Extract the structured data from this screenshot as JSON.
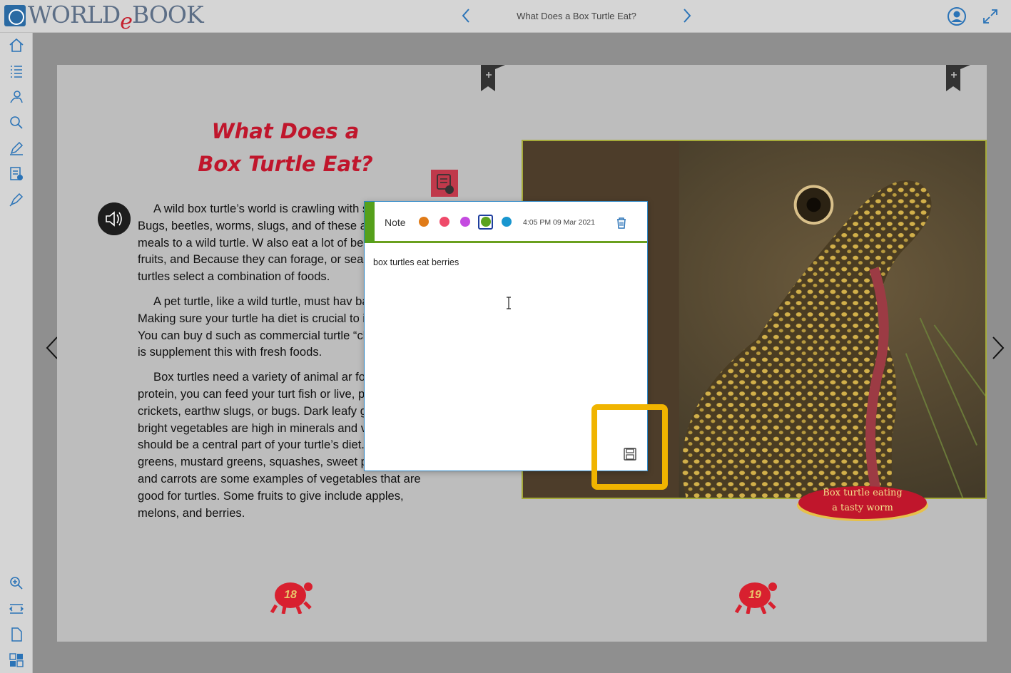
{
  "header": {
    "logo_text_prefix": "WORLD",
    "logo_text_e": "e",
    "logo_text_suffix": "BOOK",
    "book_title": "What Does a Box Turtle Eat?"
  },
  "page": {
    "title_line1": "What Does a",
    "title_line2": "Box Turtle Eat?",
    "paragraphs": [
      "A wild box turtle’s world is crawling with snacks. Bugs, beetles, worms, slugs, and of these are tasty meals to a wild turtle. W also eat a lot of berries, other fruits, and Because they can forage, or search, for f turtles select a combination of foods.",
      "A pet turtle, like a wild turtle, must hav balanced diet. Making sure your turtle ha diet is crucial to its health. You can buy d such as commercial turtle “chow,” but it is supplement this with fresh foods.",
      "Box turtles need a variety of animal ar foods. For protein, you can feed your turt fish or live, pesticide-free crickets, earthw slugs, or bugs. Dark leafy green or bright vegetables are high in minerals and vitamins and should be a central part of your turtle’s diet. Collard greens, mustard greens, squashes, sweet potatoes, and carrots are some examples of vegetables that are good for turtles. Some fruits to give include apples, melons, and berries."
    ],
    "caption_line1": "Box turtle eating",
    "caption_line2": "a tasty worm",
    "left_page_number": "18",
    "right_page_number": "19"
  },
  "note": {
    "label": "Note",
    "timestamp": "4:05 PM 09 Mar 2021",
    "text": "box turtles eat berries",
    "colors": [
      "#e07b18",
      "#ef4a6a",
      "#c44be0",
      "#5ba21e",
      "#1996cf"
    ],
    "selected_color_index": 3
  },
  "icons": {
    "rail": [
      "home-icon",
      "table-of-contents-icon",
      "glossary-icon",
      "search-icon",
      "annotate-icon",
      "notes-icon",
      "highlighter-icon",
      "zoom-in-icon",
      "fit-width-icon",
      "single-page-icon",
      "thumbnails-icon"
    ]
  }
}
